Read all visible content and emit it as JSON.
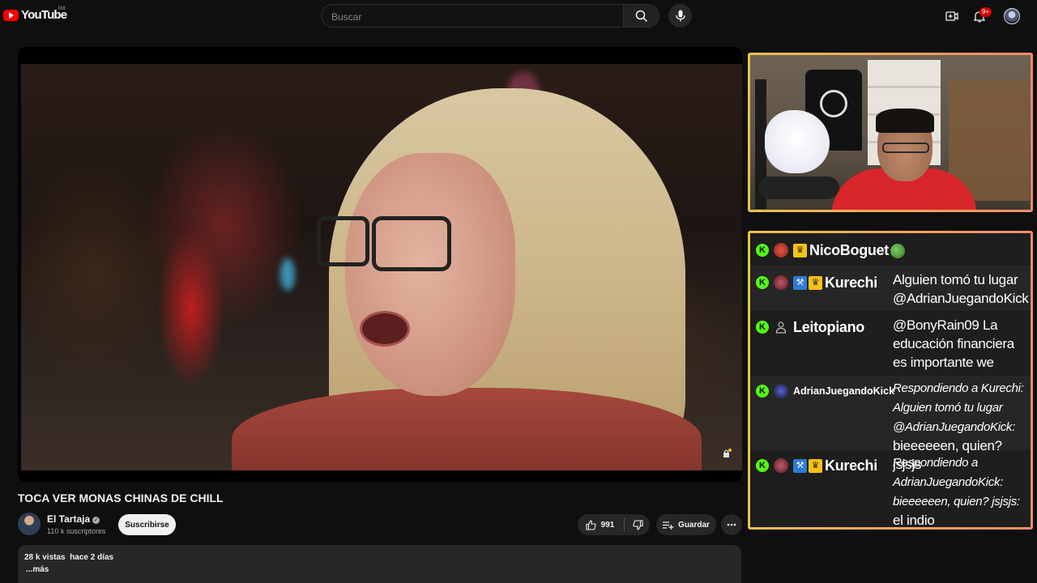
{
  "header": {
    "logo_text": "YouTube",
    "country_code": "MX",
    "search_placeholder": "Buscar",
    "notification_count": "9+"
  },
  "video": {
    "title": "TOCA VER MONAS CHINAS DE CHILL",
    "channel_name": "El Tartaja",
    "subscribers": "110 k suscriptores",
    "subscribe_label": "Suscribirse",
    "like_count": "991",
    "save_label": "Guardar",
    "views": "28 k vistas",
    "uploaded": "hace 2 días",
    "more_label": "...más"
  },
  "chat": {
    "messages": [
      {
        "user": "NicoBoguet",
        "text": ""
      },
      {
        "user": "Kurechi",
        "text": "Alguien tomó tu lugar @AdrianJuegandoKick"
      },
      {
        "user": "Leitopiano",
        "text": "@BonyRain09 La educación financiera es importante we"
      },
      {
        "user": "AdrianJuegandoKick",
        "reply": "Respondiendo a Kurechi: Alguien tomó tu lugar @AdrianJuegandoKick:",
        "text": "bieeeeeen, quien? jsjsjs"
      },
      {
        "user": "Kurechi",
        "reply": "Respondiendo a AdrianJuegandoKick: bieeeeeen, quien? jsjsjs:",
        "text": "el indio"
      }
    ]
  },
  "colors": {
    "accent_red": "#ff0000",
    "kick_green": "#53fc18",
    "overlay_border_start": "#e9c24f",
    "overlay_border_end": "#f28a6a"
  }
}
